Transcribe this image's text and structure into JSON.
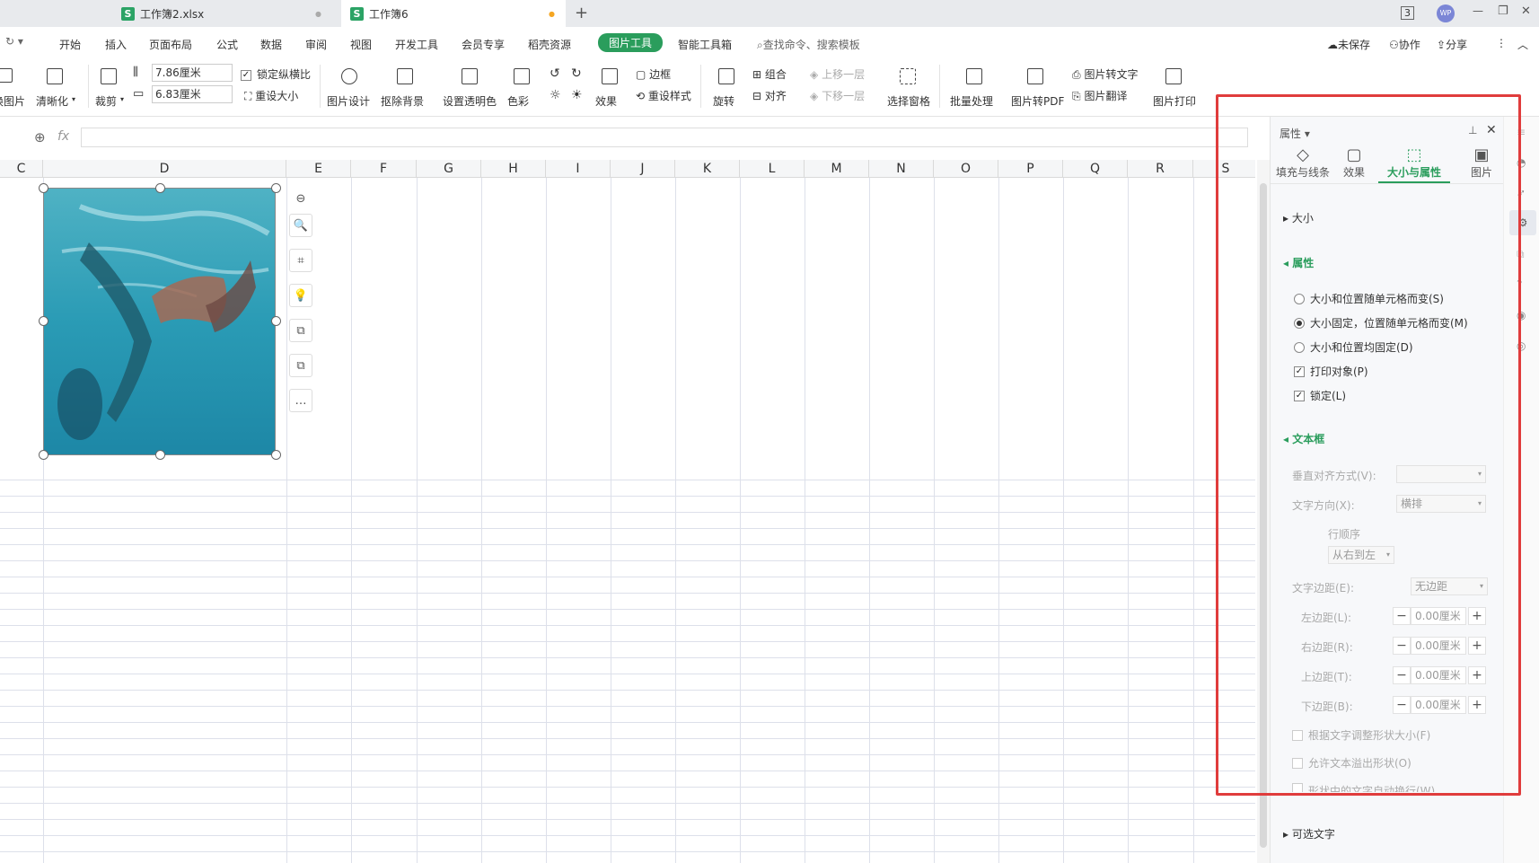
{
  "tabs": [
    {
      "label": "工作簿2.xlsx",
      "badge": "S",
      "close": "●"
    },
    {
      "label": "工作簿6",
      "badge": "S",
      "close": "●"
    }
  ],
  "new_tab": "+",
  "title_controls": {
    "badge3": "3",
    "avatar": "WP",
    "minimize": "—",
    "restore": "❐",
    "close": "✕"
  },
  "menu": {
    "items": [
      "开始",
      "插入",
      "页面布局",
      "公式",
      "数据",
      "审阅",
      "视图",
      "开发工具",
      "会员专享",
      "稻壳资源",
      "图片工具",
      "智能工具箱"
    ],
    "search": "查找命令、搜索模板",
    "unsaved": "未保存",
    "collab": "协作",
    "share": "分享"
  },
  "ribbon": {
    "replace_pic": "换图片",
    "sharpen": "清晰化",
    "crop": "裁剪",
    "width": "7.86厘米",
    "height": "6.83厘米",
    "lock_ratio": "锁定纵横比",
    "reset_size": "重设大小",
    "pic_design": "图片设计",
    "remove_bg": "抠除背景",
    "set_transparent": "设置透明色",
    "color": "色彩",
    "effect": "效果",
    "border": "边框",
    "reset_style": "重设样式",
    "rotate": "旋转",
    "group": "组合",
    "align": "对齐",
    "bring_forward": "上移一层",
    "send_backward": "下移一层",
    "select_pane": "选择窗格",
    "batch": "批量处理",
    "to_pdf": "图片转PDF",
    "to_text": "图片转文字",
    "translate": "图片翻译",
    "print": "图片打印"
  },
  "formula": {
    "fx": "fx"
  },
  "columns": [
    "C",
    "D",
    "E",
    "F",
    "G",
    "H",
    "I",
    "J",
    "K",
    "L",
    "M",
    "N",
    "O",
    "P",
    "Q",
    "R",
    "S"
  ],
  "float_tools": [
    "⊖",
    "🔍",
    "⌗",
    "💡",
    "⧉",
    "⧉",
    "…"
  ],
  "panel": {
    "header": "属性",
    "tabs": [
      "填充与线条",
      "效果",
      "大小与属性",
      "图片"
    ],
    "size_section": "大小",
    "props_section": "属性",
    "options": [
      {
        "label": "大小和位置随单元格而变(S)",
        "type": "radio",
        "checked": false
      },
      {
        "label": "大小固定，位置随单元格而变(M)",
        "type": "radio",
        "checked": true
      },
      {
        "label": "大小和位置均固定(D)",
        "type": "radio",
        "checked": false
      },
      {
        "label": "打印对象(P)",
        "type": "checkbox",
        "checked": true
      },
      {
        "label": "锁定(L)",
        "type": "checkbox",
        "checked": true
      }
    ],
    "textbox_section": "文本框",
    "valign_label": "垂直对齐方式(V):",
    "valign_value": "",
    "textdir_label": "文字方向(X):",
    "textdir_value": "横排",
    "line_order_label": "行顺序",
    "line_order_value": "从右到左",
    "margin_label": "文字边距(E):",
    "margin_value": "无边距",
    "margins": [
      {
        "label": "左边距(L):",
        "value": "0.00厘米"
      },
      {
        "label": "右边距(R):",
        "value": "0.00厘米"
      },
      {
        "label": "上边距(T):",
        "value": "0.00厘米"
      },
      {
        "label": "下边距(B):",
        "value": "0.00厘米"
      }
    ],
    "autofit": "根据文字调整形状大小(F)",
    "overflow": "允许文本溢出形状(O)",
    "wrap": "形状中的文字自动换行(W)",
    "alt_text": "可选文字"
  },
  "colors": {
    "accent_green": "#2a9d5c",
    "highlight_red": "#e03c3c"
  }
}
